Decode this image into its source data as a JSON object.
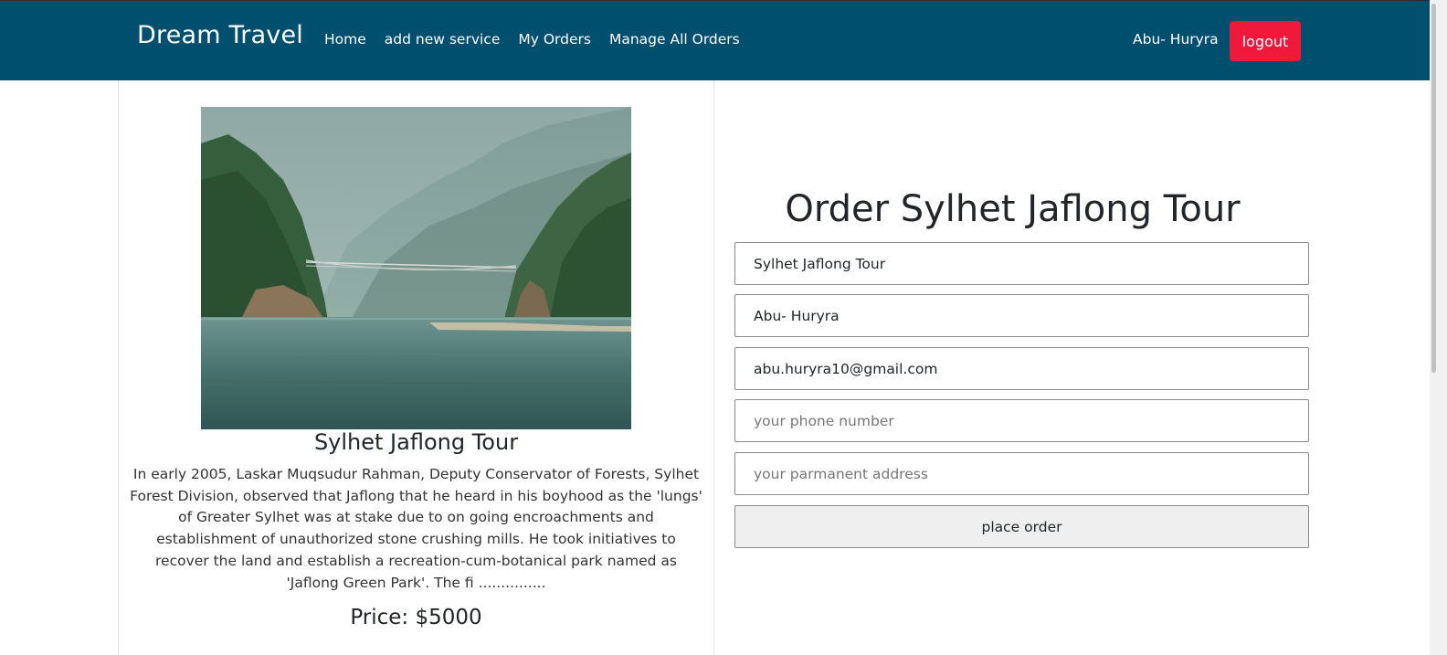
{
  "navbar": {
    "brand": "Dream Travel",
    "links": [
      "Home",
      "add new service",
      "My Orders",
      "Manage All Orders"
    ],
    "user_name": "Abu- Huryra",
    "logout_label": "logout",
    "background_color": "#004f6f",
    "logout_color": "#f0193c"
  },
  "service": {
    "image_icon": "river-valley-bridge-photo",
    "title": "Sylhet Jaflong Tour",
    "description": "In early 2005, Laskar Muqsudur Rahman, Deputy Conservator of Forests, Sylhet Forest Division, observed that Jaflong that he heard in his boyhood as the 'lungs' of Greater Sylhet was at stake due to on going encroachments and establishment of unauthorized stone crushing mills. He took initiatives to recover the land and establish a recreation-cum-botanical park named as 'Jaflong Green Park'. The fi ...............",
    "price": "Price: $5000"
  },
  "order_form": {
    "heading": "Order Sylhet Jaflong Tour",
    "service_name_value": "Sylhet Jaflong Tour",
    "user_name_value": "Abu- Huryra",
    "email_value": "abu.huryra10@gmail.com",
    "phone_placeholder": "your phone number",
    "address_placeholder": "your parmanent address",
    "submit_label": "place order"
  }
}
